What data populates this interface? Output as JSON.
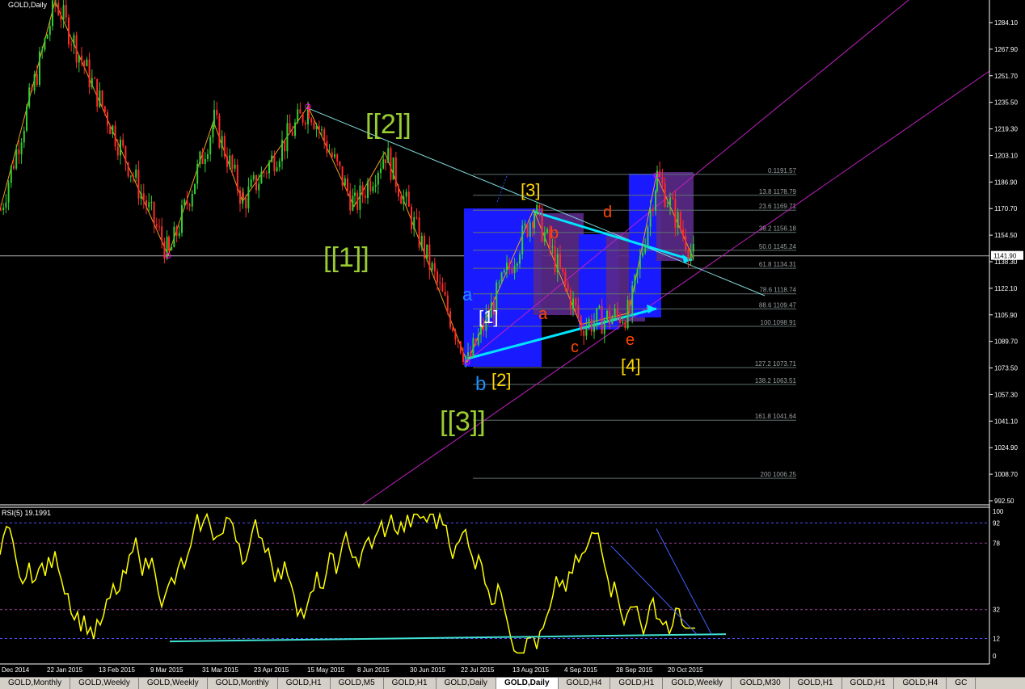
{
  "window": {
    "title": "GOLD,Daily"
  },
  "rsi": {
    "label": "RSI(5) 19.1991"
  },
  "price_axis": {
    "ticks": [
      "1284.10",
      "1267.90",
      "1251.70",
      "1235.50",
      "1219.30",
      "1203.10",
      "1186.90",
      "1170.70",
      "1154.50",
      "1138.30",
      "1122.10",
      "1105.90",
      "1089.70",
      "1073.50",
      "1057.30",
      "1041.10",
      "1024.90",
      "1008.70",
      "992.50"
    ],
    "current_price": "1141.90",
    "current_price_color": "#ffffff"
  },
  "rsi_axis": {
    "ticks": [
      "100",
      "92",
      "78",
      "32",
      "12",
      "0"
    ]
  },
  "date_axis": [
    "Dec 2014",
    "22 Jan 2015",
    "13 Feb 2015",
    "9 Mar 2015",
    "31 Mar 2015",
    "23 Apr 2015",
    "15 May 2015",
    "8 Jun 2015",
    "30 Jun 2015",
    "22 Jul 2015",
    "13 Aug 2015",
    "4 Sep 2015",
    "28 Sep 2015",
    "20 Oct 2015"
  ],
  "fib_levels": [
    {
      "label": "0.1191.57",
      "price": 1191.57
    },
    {
      "label": "13.8 1178.79",
      "price": 1178.79
    },
    {
      "label": "23.6 1169.71",
      "price": 1169.71
    },
    {
      "label": "38.2 1156.18",
      "price": 1156.18
    },
    {
      "label": "50.0 1145.24",
      "price": 1145.24
    },
    {
      "label": "61.8 1134.31",
      "price": 1134.31
    },
    {
      "label": "78.6 1118.74",
      "price": 1118.74
    },
    {
      "label": "88.6 1109.47",
      "price": 1109.47
    },
    {
      "label": "100.1098.91",
      "price": 1098.91
    },
    {
      "label": "127.2 1073.71",
      "price": 1073.71
    },
    {
      "label": "138.2 1063.51",
      "price": 1063.51
    },
    {
      "label": "161.8 1041.64",
      "price": 1041.64
    },
    {
      "label": "200 1006.25",
      "price": 1006.25
    }
  ],
  "wave_labels": [
    {
      "text": "[[2]]",
      "color": "#9acd32"
    },
    {
      "text": "[[1]]",
      "color": "#9acd32"
    },
    {
      "text": "[[3]]",
      "color": "#9acd32"
    },
    {
      "text": "[3]",
      "color": "#ffd700"
    },
    {
      "text": "[1]",
      "color": "#ffffff"
    },
    {
      "text": "[2]",
      "color": "#ffd700"
    },
    {
      "text": "[4]",
      "color": "#ffd700"
    },
    {
      "text": "a",
      "color": "#1e90ff"
    },
    {
      "text": "b",
      "color": "#1e90ff"
    },
    {
      "text": "a",
      "color": "#ff4500"
    },
    {
      "text": "b",
      "color": "#ff4500"
    },
    {
      "text": "c",
      "color": "#ff4500"
    },
    {
      "text": "d",
      "color": "#ff4500"
    },
    {
      "text": "e",
      "color": "#ff4500"
    }
  ],
  "tabs": [
    {
      "label": "GOLD,Monthly",
      "active": false
    },
    {
      "label": "GOLD,Weekly",
      "active": false
    },
    {
      "label": "GOLD,Weekly",
      "active": false
    },
    {
      "label": "GOLD,Monthly",
      "active": false
    },
    {
      "label": "GOLD,H1",
      "active": false
    },
    {
      "label": "GOLD,M5",
      "active": false
    },
    {
      "label": "GOLD,H1",
      "active": false
    },
    {
      "label": "GOLD,Daily",
      "active": false
    },
    {
      "label": "GOLD,Daily",
      "active": true
    },
    {
      "label": "GOLD,H4",
      "active": false
    },
    {
      "label": "GOLD,H1",
      "active": false
    },
    {
      "label": "GOLD,Weekly",
      "active": false
    },
    {
      "label": "GOLD,M30",
      "active": false
    },
    {
      "label": "GOLD,H1",
      "active": false
    },
    {
      "label": "GOLD,H1",
      "active": false
    },
    {
      "label": "GOLD,H4",
      "active": false
    },
    {
      "label": "GC",
      "active": false
    }
  ],
  "colors": {
    "bull": "#32cd32",
    "bear": "#ff2a2a",
    "rsi_line": "#ffff00",
    "channel": "#c020c0",
    "trend": "#00e5ff",
    "zigzag": "#f0a020"
  },
  "chart_data": {
    "type": "candlestick",
    "symbol": "GOLD",
    "timeframe": "Daily",
    "ylim": [
      992.5,
      1292
    ],
    "current_price": 1141.9,
    "swing_points": [
      {
        "date": "Dec 2014",
        "price": 1170
      },
      {
        "date": "22 Jan 2015",
        "price": 1297
      },
      {
        "date": "9 Mar 2015",
        "price": 1142
      },
      {
        "date": "31 Mar 2015",
        "price": 1224
      },
      {
        "date": "23 Apr 2015",
        "price": 1175
      },
      {
        "date": "15 May 2015",
        "price": 1233
      },
      {
        "date": "8 Jun 2015",
        "price": 1172
      },
      {
        "date": "30 Jun 2015",
        "price": 1205
      },
      {
        "date": "22 Jul 2015",
        "price": 1077
      },
      {
        "date": "13 Aug 2015",
        "price": 1170
      },
      {
        "date": "4 Sep 2015",
        "price": 1100
      },
      {
        "date": "28 Sep 2015",
        "price": 1107
      },
      {
        "date": "20 Oct 2015",
        "price": 1191
      },
      {
        "date": "20 Oct 2015",
        "price": 1140
      }
    ],
    "rsi": {
      "period": 5,
      "value": 19.1991,
      "levels": [
        92,
        78,
        32,
        12
      ]
    }
  }
}
